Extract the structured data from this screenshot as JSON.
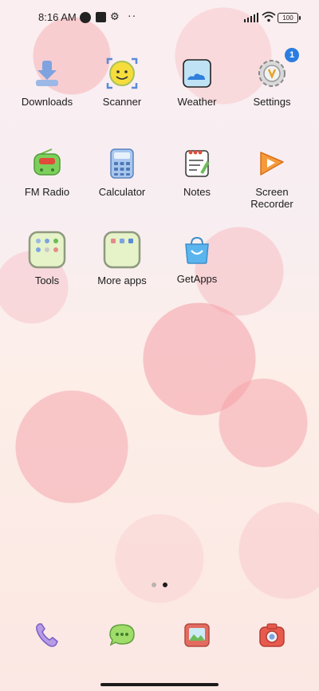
{
  "status": {
    "time": "8:16 AM",
    "battery": "100"
  },
  "apps": [
    {
      "name": "Downloads",
      "icon": "download-icon"
    },
    {
      "name": "Scanner",
      "icon": "scanner-icon"
    },
    {
      "name": "Weather",
      "icon": "weather-icon"
    },
    {
      "name": "Settings",
      "icon": "settings-icon",
      "badge": "1"
    },
    {
      "name": "FM Radio",
      "icon": "radio-icon"
    },
    {
      "name": "Calculator",
      "icon": "calculator-icon"
    },
    {
      "name": "Notes",
      "icon": "notes-icon"
    },
    {
      "name": "Screen Recorder",
      "icon": "screen-recorder-icon"
    },
    {
      "name": "Tools",
      "icon": "folder-icon"
    },
    {
      "name": "More apps",
      "icon": "folder-icon"
    },
    {
      "name": "GetApps",
      "icon": "getapps-icon"
    }
  ],
  "dock": [
    {
      "icon": "phone-icon"
    },
    {
      "icon": "messages-icon"
    },
    {
      "icon": "gallery-icon"
    },
    {
      "icon": "camera-icon"
    }
  ]
}
